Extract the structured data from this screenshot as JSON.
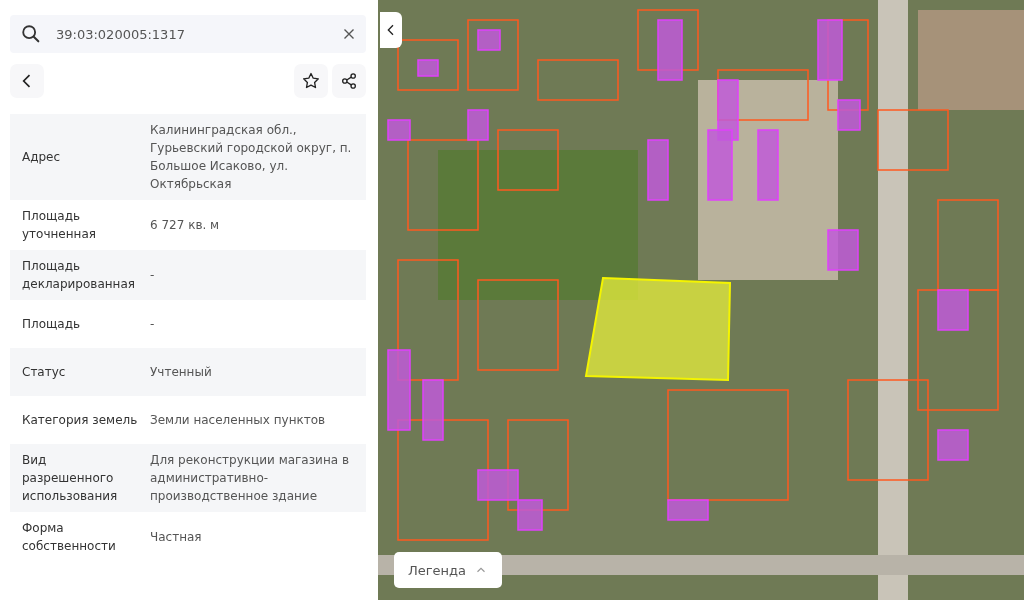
{
  "search": {
    "value": "39:03:020005:1317"
  },
  "properties": [
    {
      "label": "Адрес",
      "value": "Калининградская обл., Гурьевский городской округ, п. Большое Исаково, ул. Октябрьская"
    },
    {
      "label": "Площадь уточненная",
      "value": "6 727 кв. м"
    },
    {
      "label": "Площадь декларированная",
      "value": "-"
    },
    {
      "label": "Площадь",
      "value": "-"
    },
    {
      "label": "Статус",
      "value": "Учтенный"
    },
    {
      "label": "Категория земель",
      "value": "Земли населенных пунктов"
    },
    {
      "label": "Вид разрешенного использования",
      "value": "Для реконструкции магазина в административно-производственное здание"
    },
    {
      "label": "Форма собственности",
      "value": "Частная"
    }
  ],
  "map": {
    "legend_button": "Легенда"
  }
}
